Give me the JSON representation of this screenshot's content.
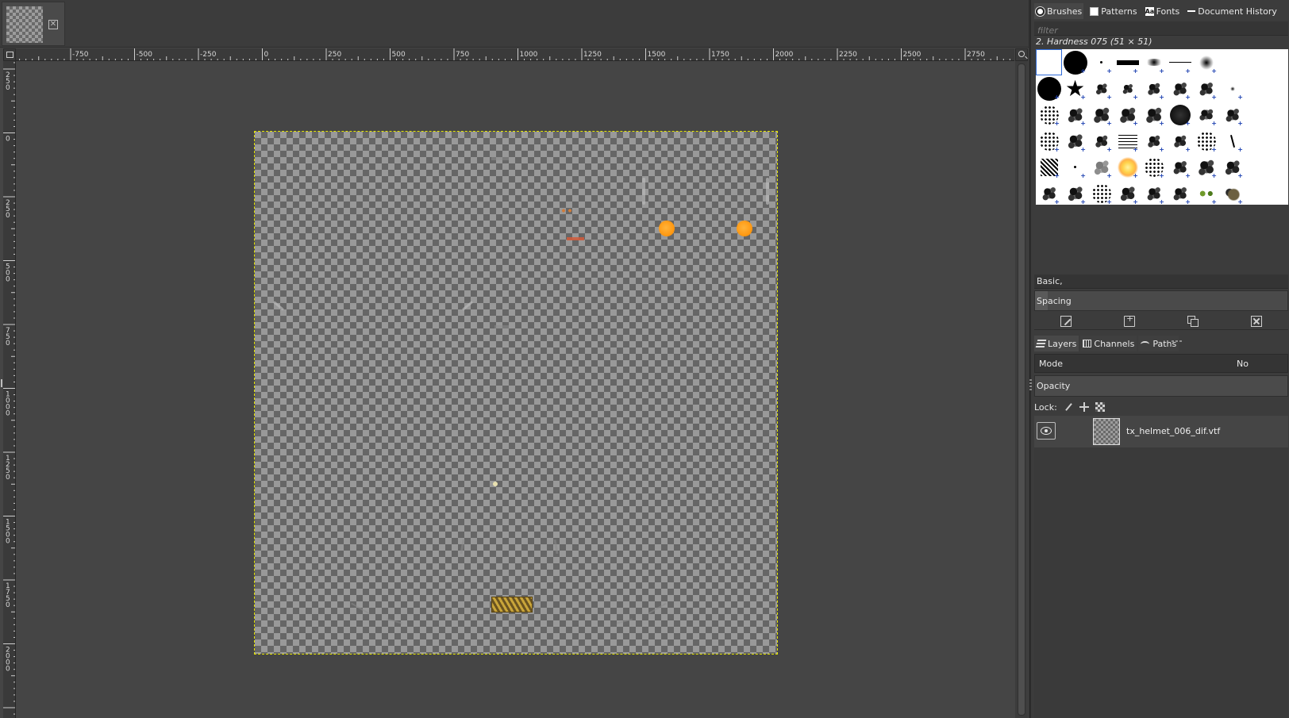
{
  "image_tab": {
    "thumbnail": "checkerboard-thumbnail",
    "close_icon": "close-icon"
  },
  "hruler": {
    "labels": [
      "-750",
      "-500",
      "-250",
      "0",
      "250",
      "500",
      "750",
      "1000",
      "1250",
      "1500",
      "1750",
      "2000",
      "2250",
      "2500",
      "2750"
    ]
  },
  "vruler": {
    "labels": [
      "250",
      "0",
      "250",
      "500",
      "750",
      "1000",
      "1250",
      "1500",
      "1750",
      "2000"
    ]
  },
  "canvas": {
    "image_name": "tx_helmet_006_dif.vtf",
    "selection_color": "#e6e600",
    "orb_color": "#ff9a14"
  },
  "brushes_dock": {
    "tabs": [
      {
        "label": "Brushes",
        "icon": "brush-icon"
      },
      {
        "label": "Patterns",
        "icon": "pattern-icon"
      },
      {
        "label": "Fonts",
        "icon": "fonts-icon"
      },
      {
        "label": "Document History",
        "icon": "history-icon"
      }
    ],
    "filter_placeholder": "filter",
    "selected_brush": "2. Hardness 075 (51 × 51)",
    "preset": "Basic,",
    "spacing_label": "Spacing",
    "spacing_fraction": 0.05
  },
  "layers_dock": {
    "tabs": [
      {
        "label": "Layers",
        "icon": "layers-icon"
      },
      {
        "label": "Channels",
        "icon": "channels-icon"
      },
      {
        "label": "Paths",
        "icon": "paths-icon"
      }
    ],
    "mode_label": "Mode",
    "mode_value": "No",
    "opacity_label": "Opacity",
    "lock_label": "Lock:",
    "layers": [
      {
        "name": "tx_helmet_006_dif.vtf",
        "visible": true
      }
    ]
  }
}
